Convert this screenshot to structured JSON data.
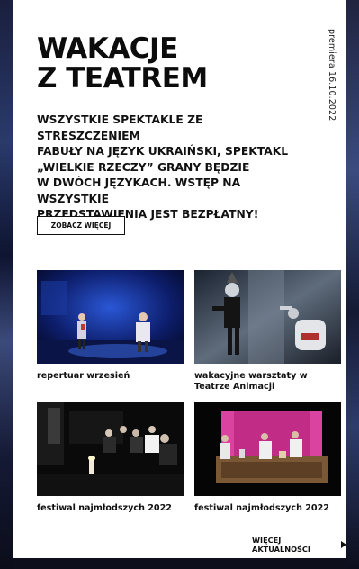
{
  "header": {
    "title_line1": "WAKACJE",
    "title_line2": "Z TEATREM",
    "premiere": "premiera 16.10.2022"
  },
  "lead_text": "WSZYSTKIE SPEKTAKLE ZE STRESZCZENIEM\nFABUŁY NA JĘZYK UKRAIŃSKI, SPEKTAKL\n„WIELKIE RZECZY” GRANY BĘDZIE\nW DWÓCH JĘZYKACH. WSTĘP NA WSZYSTKIE\nPRZEDSTAWIENIA JEST BEZPŁATNY!",
  "see_more_button": "ZOBACZ WIĘCEJ",
  "tiles": [
    {
      "caption": "repertuar wrzesień",
      "image": "stage-photo-blue"
    },
    {
      "caption": "wakacyjne warsztaty w Teatrze Animacji",
      "image": "stage-photo-grey"
    },
    {
      "caption": "festiwal najmłodszych 2022",
      "image": "stage-photo-dark"
    },
    {
      "caption": "festiwal najmłodszych 2022",
      "image": "stage-photo-pink"
    }
  ],
  "more_news_link": "WIĘCEJ AKTUALNOŚCI",
  "colors": {
    "card": "#ffffff",
    "text": "#111111",
    "page_bg": "#0d0f1c"
  }
}
